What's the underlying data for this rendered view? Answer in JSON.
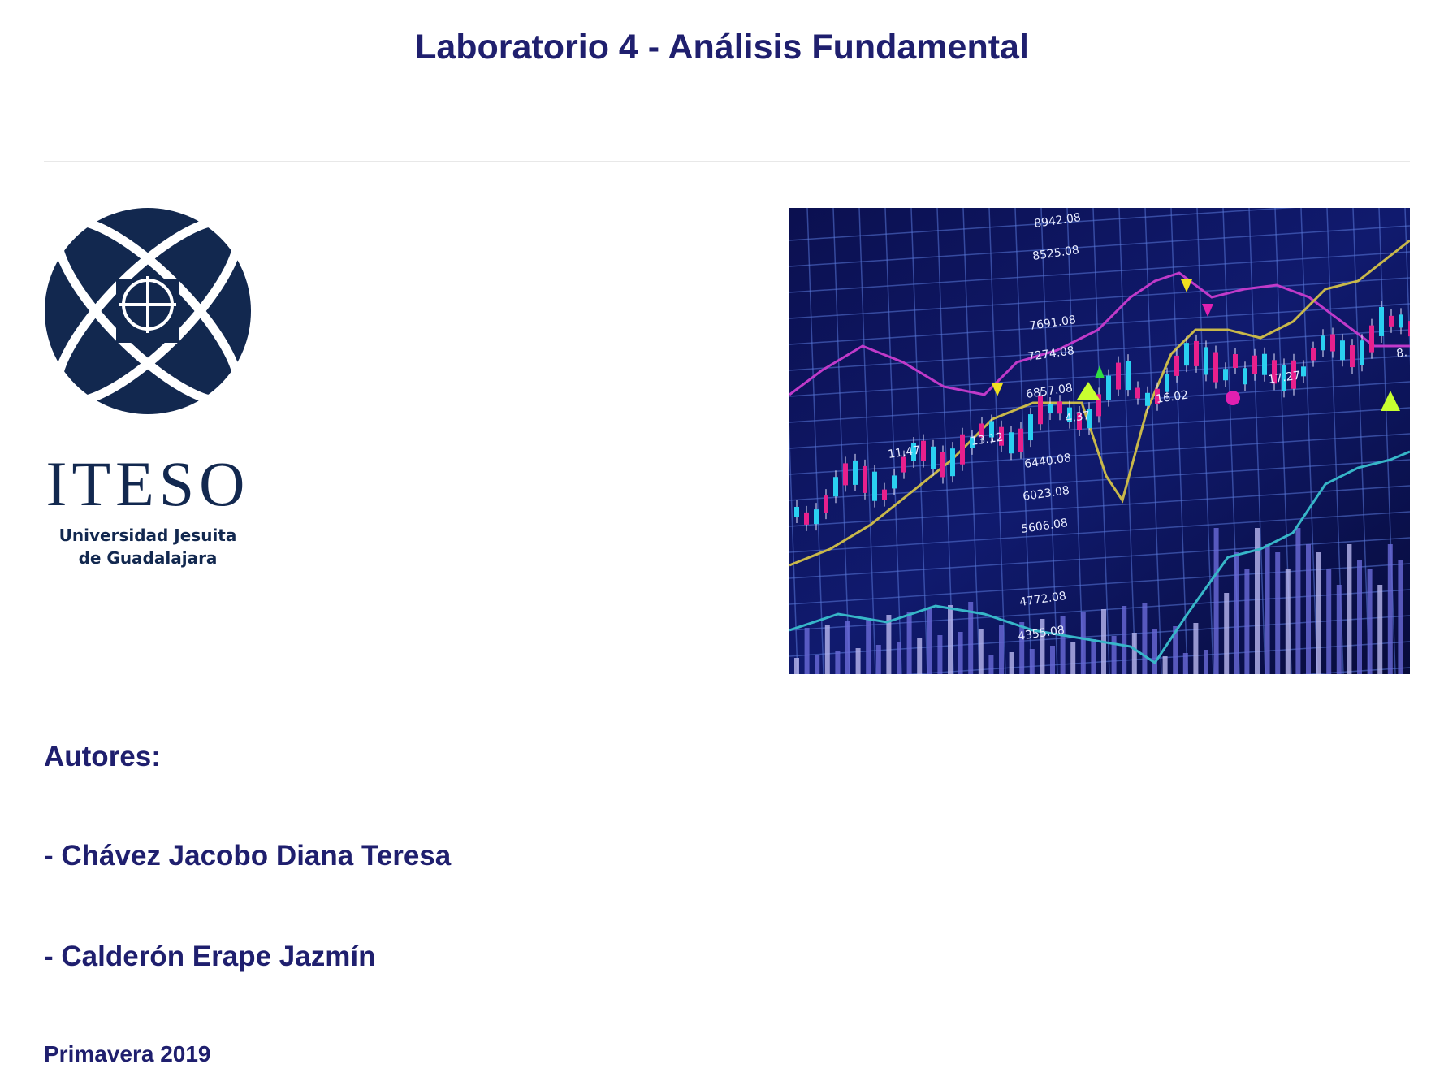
{
  "title": "Laboratorio 4 - Análisis Fundamental",
  "logo": {
    "word": "ITESO",
    "subtitle_line1": "Universidad Jesuita",
    "subtitle_line2": "de Guadalajara",
    "color": "#12284f"
  },
  "photo": {
    "labels": [
      "8942.08",
      "8525.08",
      "7691.08",
      "7274.08",
      "6857.08",
      "6440.08",
      "6023.08",
      "5606.08",
      "4772.08",
      "4355.08",
      "17.27",
      "16.02",
      "13.12",
      "11.47",
      "4.37",
      "8."
    ]
  },
  "authors_heading": "Autores:",
  "authors": [
    "- Chávez Jacobo Diana Teresa",
    "- Calderón Erape Jazmín"
  ],
  "term": "Primavera 2019",
  "colors": {
    "heading": "#1f1f6e",
    "rule": "#e8e8e8"
  }
}
